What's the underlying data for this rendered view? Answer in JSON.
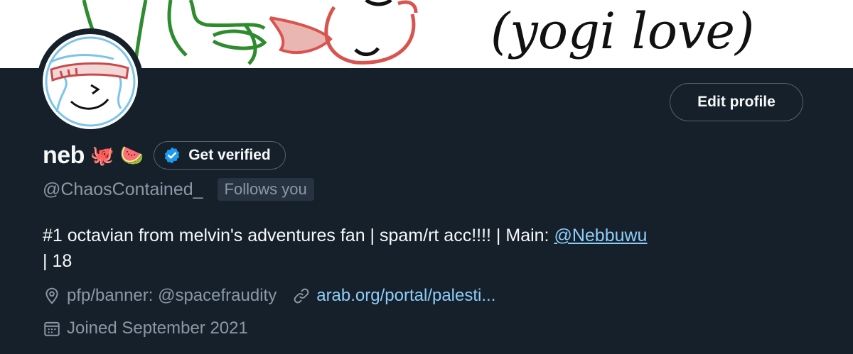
{
  "banner": {
    "handwriting": "(yogi love)"
  },
  "profile": {
    "edit_profile_label": "Edit profile",
    "display_name": "neb",
    "name_emojis": [
      "🐙",
      "🍉"
    ],
    "get_verified_label": "Get verified",
    "handle": "@ChaosContained_",
    "follows_you_label": "Follows you",
    "bio": {
      "text": "#1 octavian from melvin's adventures fan | spam/rt acc!!!! | Main: ",
      "mention": "@Nebbuwu",
      "suffix": "| 18"
    },
    "location": "pfp/banner: @spacefraudity",
    "website": "arab.org/portal/palesti...",
    "joined": "Joined September 2021"
  },
  "icons": {
    "location": "location-pin-icon",
    "link": "link-icon",
    "calendar": "calendar-icon",
    "verified": "verified-badge-icon"
  },
  "colors": {
    "background": "#15202b",
    "text_primary": "#f7f9f9",
    "text_secondary": "#8b98a5",
    "link": "#8ecdf8",
    "verified_blue": "#1d9bf0",
    "border": "#536471"
  }
}
